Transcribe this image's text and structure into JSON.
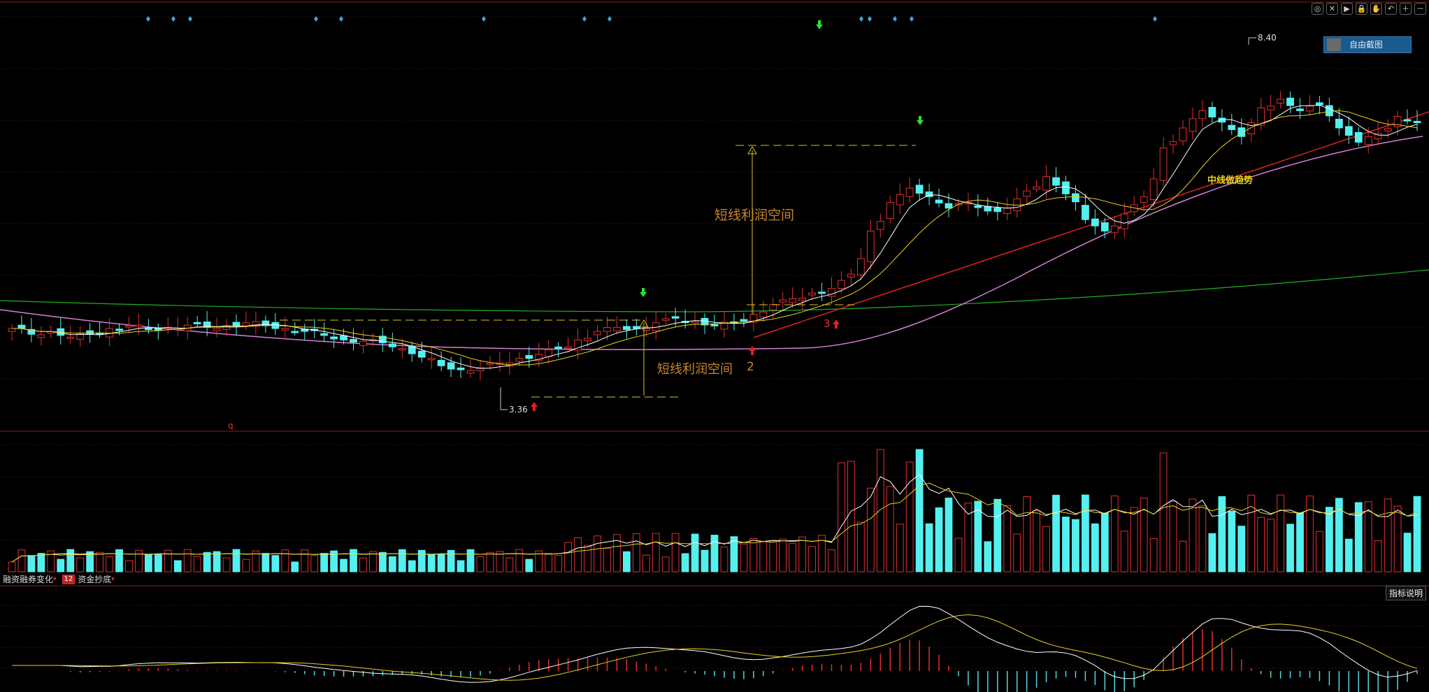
{
  "toolbar": {
    "icons": [
      "eye-icon",
      "close-icon",
      "play-icon",
      "lock-icon",
      "hand-icon",
      "undo-icon",
      "zoom-in-icon",
      "zoom-out-icon"
    ],
    "glyphs": [
      "◎",
      "✕",
      "▶",
      "🔒",
      "✋",
      "↶",
      "＋",
      "－"
    ]
  },
  "free_screenshot_label": "自由截图",
  "annotations": {
    "high_price": "8.40",
    "low_price": "3.36",
    "profit_space_upper": "短线利润空间",
    "profit_space_lower": "短线利润空间",
    "marker_2": "2",
    "marker_3": "3",
    "trend_label": "中线做趋势",
    "marker_q": "q"
  },
  "indicator_tabs": [
    {
      "label": "融资融券变化",
      "num": ""
    },
    {
      "label": "资金抄底",
      "num": "12"
    }
  ],
  "indicator_help": "指标说明",
  "colors": {
    "up": "#e03030",
    "down": "#54f0f0",
    "ma5": "#ffffff",
    "ma10": "#e8d21d",
    "ma_long": "#d57fd5",
    "ma_green": "#20b020",
    "trend": "#e02020",
    "annotation": "#c8862a"
  },
  "chart_data": {
    "type": "candlestick",
    "high_label": 8.4,
    "low_label": 3.36,
    "closes": [
      4.1,
      4.0,
      4.05,
      3.95,
      4.0,
      4.1,
      4.15,
      4.08,
      4.12,
      4.16,
      4.12,
      4.15,
      4.2,
      4.15,
      4.1,
      4.05,
      3.98,
      3.9,
      3.88,
      3.85,
      3.75,
      3.6,
      3.45,
      3.38,
      3.42,
      3.5,
      3.58,
      3.65,
      3.75,
      3.9,
      4.05,
      4.12,
      4.1,
      4.2,
      4.28,
      4.22,
      4.15,
      4.2,
      4.35,
      4.52,
      4.62,
      4.72,
      4.8,
      5.05,
      5.8,
      6.3,
      6.55,
      6.4,
      6.2,
      6.3,
      6.15,
      6.2,
      6.5,
      6.75,
      6.45,
      6.0,
      5.8,
      6.1,
      6.4,
      7.25,
      7.6,
      7.9,
      7.7,
      7.45,
      7.95,
      8.1,
      7.9,
      8.0,
      7.6,
      7.35,
      7.5,
      7.8,
      7.7
    ]
  }
}
